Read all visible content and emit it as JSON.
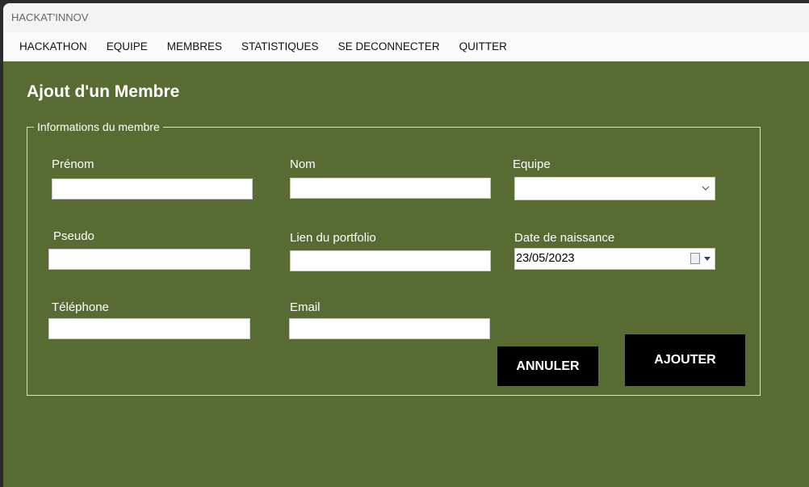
{
  "window": {
    "title": "HACKAT'INNOV"
  },
  "menu": {
    "items": [
      "HACKATHON",
      "EQUIPE",
      "MEMBRES",
      "STATISTIQUES",
      "SE DECONNECTER",
      "QUITTER"
    ]
  },
  "form": {
    "title": "Ajout d'un Membre",
    "group_label": "Informations du membre",
    "fields": {
      "prenom": {
        "label": "Prénom",
        "value": ""
      },
      "nom": {
        "label": "Nom",
        "value": ""
      },
      "equipe": {
        "label": "Equipe",
        "value": ""
      },
      "pseudo": {
        "label": "Pseudo",
        "value": ""
      },
      "portfolio": {
        "label": "Lien du portfolio",
        "value": ""
      },
      "naissance": {
        "label": "Date de naissance",
        "value": "23/05/2023"
      },
      "telephone": {
        "label": "Téléphone",
        "value": ""
      },
      "email": {
        "label": "Email",
        "value": ""
      }
    },
    "buttons": {
      "cancel": "ANNULER",
      "add": "AJOUTER"
    }
  },
  "colors": {
    "background": "#586b32",
    "button": "#000000",
    "text": "#ffffff"
  },
  "icons": {
    "dropdown": "chevron-down-icon",
    "calendar": "calendar-icon"
  }
}
